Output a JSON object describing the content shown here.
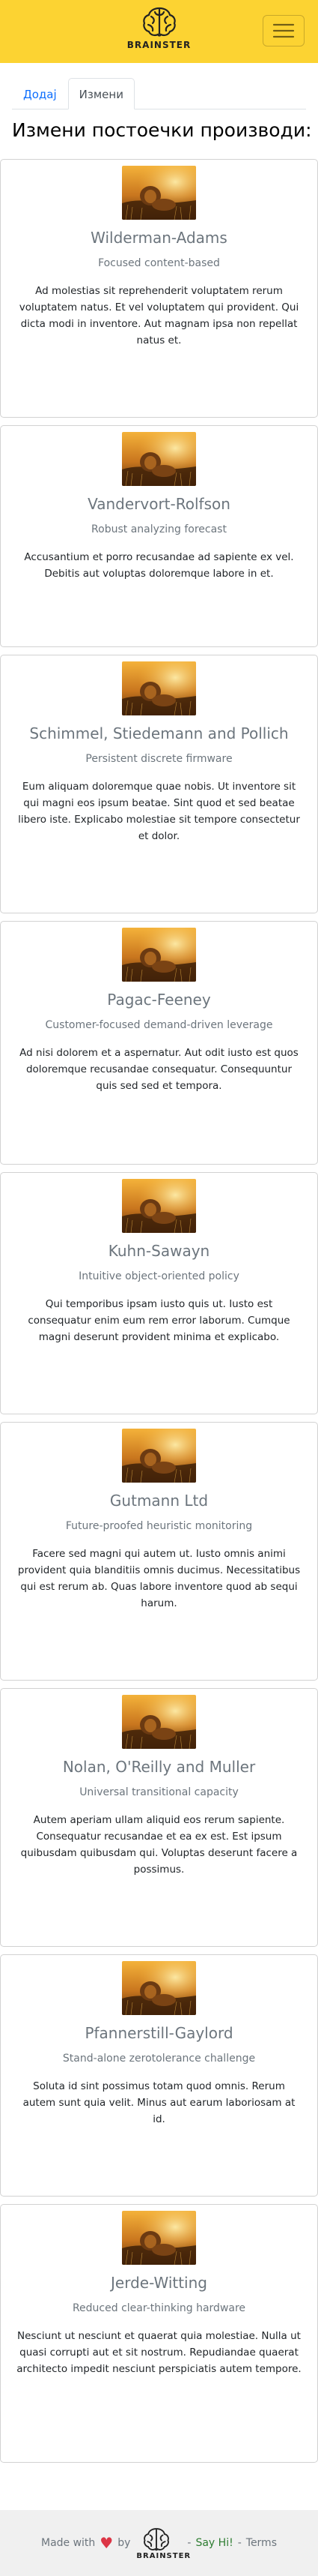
{
  "brand": {
    "name": "BRAINSTER",
    "accent": "#fcd332"
  },
  "tabs": [
    {
      "label": "Додај",
      "active": false
    },
    {
      "label": "Измени",
      "active": true
    }
  ],
  "page_title": "Измени постоечки производи:",
  "cards": [
    {
      "name": "Wilderman-Adams",
      "tagline": "Focused content-based",
      "description": "Ad molestias sit reprehenderit voluptatem rerum voluptatem natus. Et vel voluptatem qui provident. Qui dicta modi in inventore. Aut magnam ipsa non repellat natus et."
    },
    {
      "name": "Vandervort-Rolfson",
      "tagline": "Robust analyzing forecast",
      "description": "Accusantium et porro recusandae ad sapiente ex vel. Debitis aut voluptas doloremque labore in et."
    },
    {
      "name": "Schimmel, Stiedemann and Pollich",
      "tagline": "Persistent discrete firmware",
      "description": "Eum aliquam doloremque quae nobis. Ut inventore sit qui magni eos ipsum beatae. Sint quod et sed beatae libero iste. Explicabo molestiae sit tempore consectetur et dolor."
    },
    {
      "name": "Pagac-Feeney",
      "tagline": "Customer-focused demand-driven leverage",
      "description": "Ad nisi dolorem et a aspernatur. Aut odit iusto est quos doloremque recusandae consequatur. Consequuntur quis sed sed et tempora."
    },
    {
      "name": "Kuhn-Sawayn",
      "tagline": "Intuitive object-oriented policy",
      "description": "Qui temporibus ipsam iusto quis ut. Iusto est consequatur enim eum rem error laborum. Cumque magni deserunt provident minima et explicabo."
    },
    {
      "name": "Gutmann Ltd",
      "tagline": "Future-proofed heuristic monitoring",
      "description": "Facere sed magni qui autem ut. Iusto omnis animi provident quia blanditiis omnis ducimus. Necessitatibus qui est rerum ab. Quas labore inventore quod ab sequi harum."
    },
    {
      "name": "Nolan, O'Reilly and Muller",
      "tagline": "Universal transitional capacity",
      "description": "Autem aperiam ullam aliquid eos rerum sapiente. Consequatur recusandae et ea ex est. Est ipsum quibusdam quibusdam qui. Voluptas deserunt facere a possimus."
    },
    {
      "name": "Pfannerstill-Gaylord",
      "tagline": "Stand-alone zerotolerance challenge",
      "description": "Soluta id sint possimus totam quod omnis. Rerum autem sunt quia velit. Minus aut earum laboriosam at id."
    },
    {
      "name": "Jerde-Witting",
      "tagline": "Reduced clear-thinking hardware",
      "description": "Nesciunt ut nesciunt et quaerat quia molestiae. Nulla ut quasi corrupti aut et sit nostrum. Repudiandae quaerat architecto impedit nesciunt perspiciatis autem tempore."
    }
  ],
  "footer": {
    "made_with": "Made with",
    "heart_icon": "heart-icon",
    "by": "by",
    "brand": "BRAINSTER",
    "separator": "-",
    "say_hi": "Say Hi!",
    "terms": "Terms"
  }
}
